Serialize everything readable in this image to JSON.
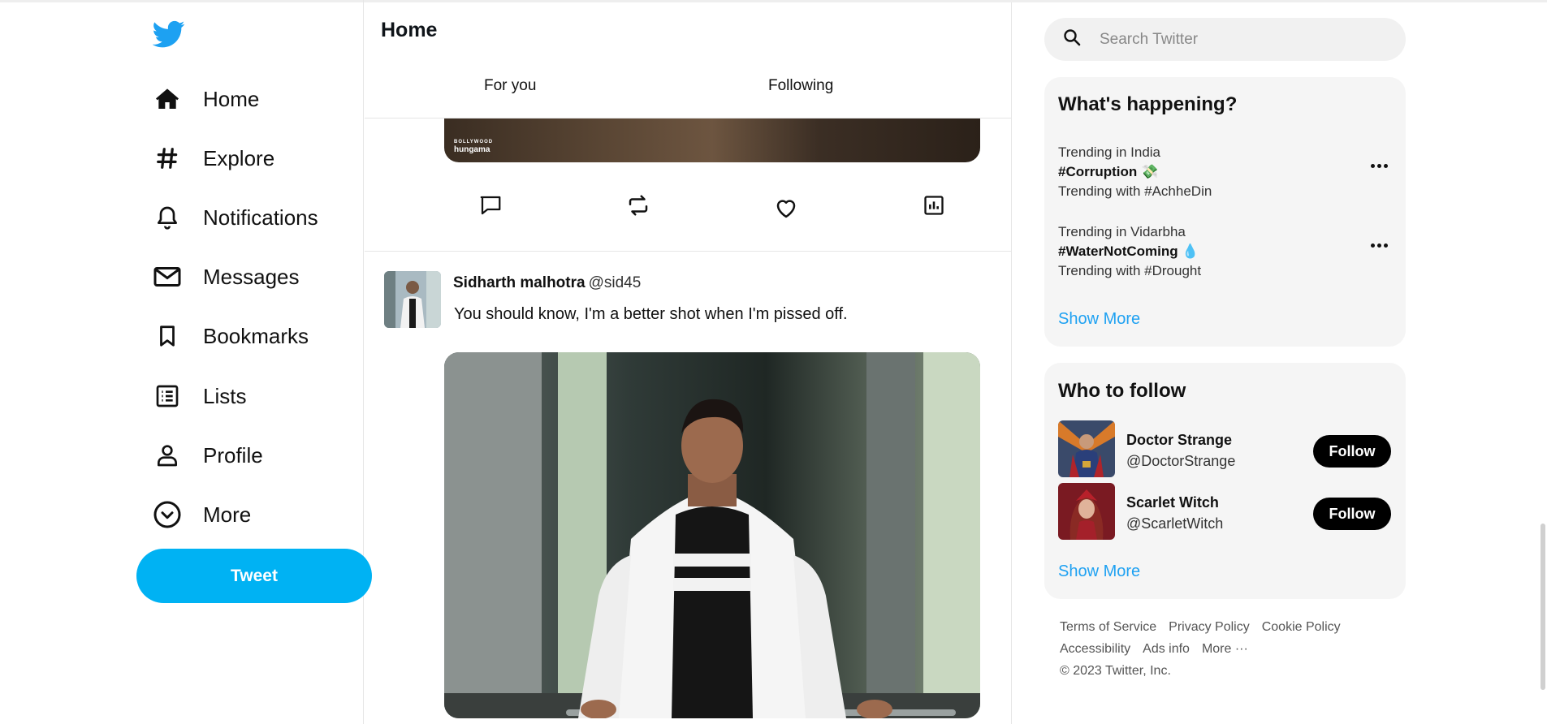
{
  "colors": {
    "brand": "#00b2f3",
    "link": "#1ea1f2",
    "follow": "#000000",
    "card": "#f5f5f5"
  },
  "icons": {
    "logo": "twitter-bird-icon",
    "nav": [
      "home-icon",
      "hashtag-icon",
      "bell-icon",
      "mail-icon",
      "bookmark-icon",
      "list-icon",
      "person-icon",
      "chevron-circle-icon"
    ],
    "actions": [
      "comment-icon",
      "retweet-icon",
      "heart-icon",
      "analytics-icon"
    ],
    "search": "search-icon",
    "more": "more-dots-icon"
  },
  "nav": {
    "items": [
      {
        "label": "Home"
      },
      {
        "label": "Explore"
      },
      {
        "label": "Notifications"
      },
      {
        "label": "Messages"
      },
      {
        "label": "Bookmarks"
      },
      {
        "label": "Lists"
      },
      {
        "label": "Profile"
      },
      {
        "label": "More"
      }
    ],
    "tweet_button": "Tweet"
  },
  "main": {
    "title": "Home",
    "tabs": [
      {
        "label": "For you"
      },
      {
        "label": "Following"
      }
    ],
    "prev_tweet": {
      "watermark_top": "BOLLYWOOD",
      "watermark": "hungama"
    },
    "tweet": {
      "name": "Sidharth malhotra",
      "handle": "@sid45",
      "text": "You should know, I'm a better shot when I'm pissed off."
    }
  },
  "search": {
    "placeholder": "Search Twitter"
  },
  "trends": {
    "title": "What's happening?",
    "items": [
      {
        "context": "Trending in India",
        "tag": "#Corruption 💸",
        "with": "Trending with #AchheDin"
      },
      {
        "context": "Trending in Vidarbha",
        "tag": "#WaterNotComing 💧",
        "with": "Trending with #Drought"
      }
    ],
    "show_more": "Show More"
  },
  "who_to_follow": {
    "title": "Who to follow",
    "users": [
      {
        "name": "Doctor Strange",
        "handle": "@DoctorStrange",
        "button": "Follow"
      },
      {
        "name": "Scarlet Witch",
        "handle": "@ScarletWitch",
        "button": "Follow"
      }
    ],
    "show_more": "Show More"
  },
  "footer": {
    "links": [
      "Terms of Service",
      "Privacy Policy",
      "Cookie Policy",
      "Accessibility",
      "Ads info",
      "More ···"
    ],
    "copyright": "© 2023 Twitter, Inc."
  }
}
